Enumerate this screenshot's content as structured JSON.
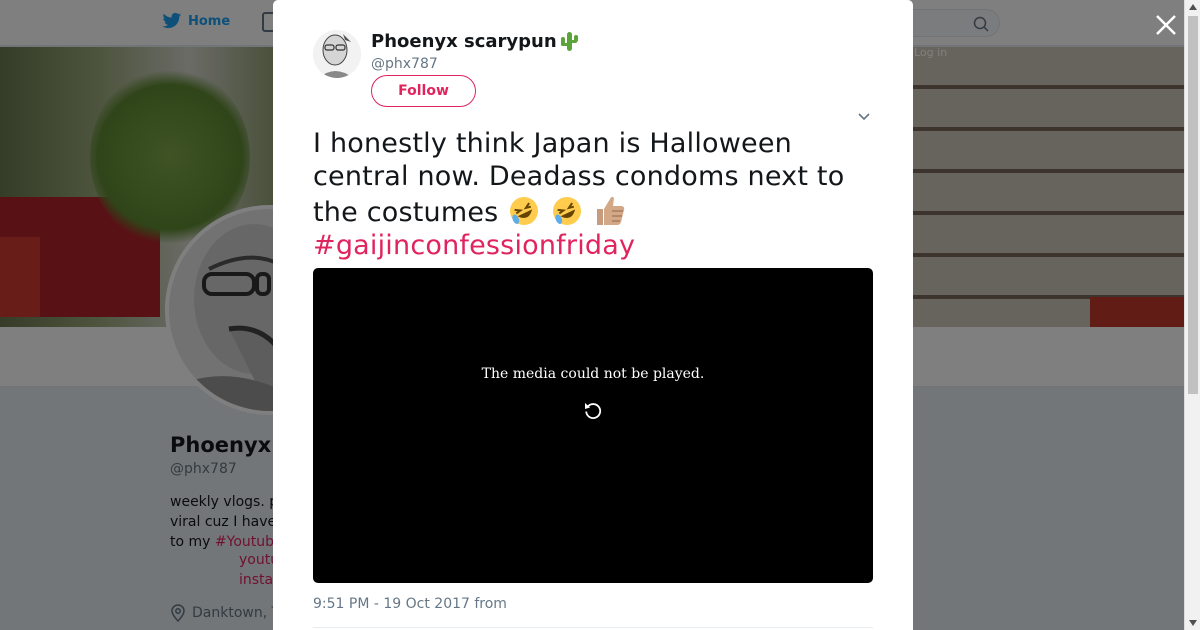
{
  "nav": {
    "home_label": "Home",
    "login_label": "Log in"
  },
  "profile": {
    "name": "Phoenyx",
    "handle": "@phx787",
    "bio_line1": "weekly vlogs. p",
    "bio_line2": "viral cuz I have",
    "bio_line3_prefix": "to my ",
    "bio_line3_hashtag": "#Youtub",
    "link1": "youtu",
    "link2": "insta",
    "location": "Danktown, T"
  },
  "tweet": {
    "author_name": "Phoenyx scarypun",
    "author_handle": "@phx787",
    "follow_label": "Follow",
    "text_line1": "I honestly think Japan is Halloween",
    "text_line2": "central now. Deadass condoms next to",
    "text_line3": "the costumes",
    "hashtag": "#gaijinconfessionfriday",
    "media_message": "The media could not be played.",
    "timestamp": "9:51 PM - 19 Oct 2017 from"
  },
  "colors": {
    "accent": "#e0245e",
    "twitter_blue": "#1da1f2",
    "secondary_text": "#657786"
  },
  "icons": {
    "close": "close-icon",
    "caret": "chevron-down-icon",
    "retry": "retry-icon",
    "location": "location-pin-icon",
    "search": "search-icon",
    "bird": "twitter-bird-icon",
    "cactus": "cactus-emoji",
    "rofl": "rofl-emoji",
    "thumb": "thumbs-up-emoji"
  }
}
